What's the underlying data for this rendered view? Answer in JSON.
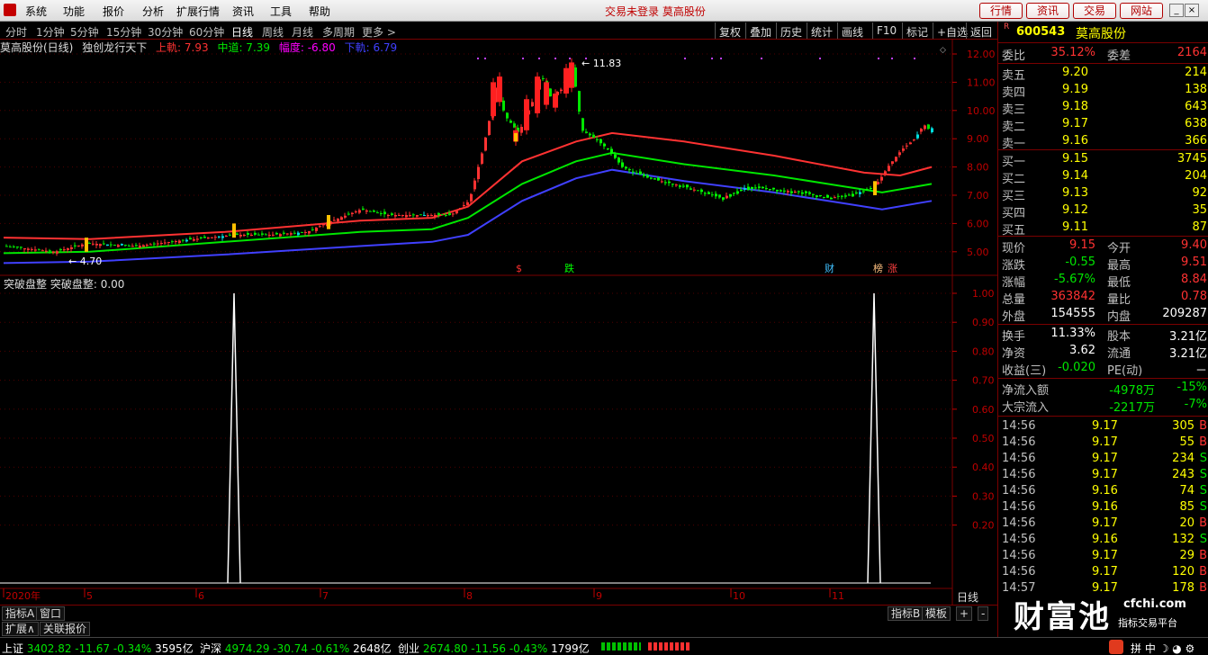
{
  "menu": {
    "items": [
      "系统",
      "功能",
      "报价",
      "分析",
      "扩展行情",
      "资讯",
      "工具",
      "帮助"
    ],
    "center_text": "交易未登录  莫高股份",
    "right_buttons": [
      "行情",
      "资讯",
      "交易",
      "网站"
    ]
  },
  "period_bar": {
    "periods": [
      "分时",
      "1分钟",
      "5分钟",
      "15分钟",
      "30分钟",
      "60分钟",
      "日线",
      "周线",
      "月线",
      "多周期",
      "更多 >"
    ],
    "active": "日线",
    "tools": [
      "复权",
      "叠加",
      "历史",
      "统计",
      "画线",
      "F10",
      "标记",
      "+自选",
      "返回"
    ]
  },
  "chart_header": {
    "name": "莫高股份(日线)",
    "indicator": "独创龙行天下",
    "upper_label": "上軌: 7.93",
    "middle_label": "中道: 7.39",
    "range_label": "幅度: -6.80",
    "lower_label": "下軌: 6.79",
    "colors": {
      "upper": "#ff3232",
      "middle": "#00e600",
      "range": "#ff00ff",
      "lower": "#4040ff"
    }
  },
  "price_axis": [
    "12.00",
    "11.00",
    "10.00",
    "9.00",
    "8.00",
    "7.00",
    "6.00",
    "5.00"
  ],
  "annotations": {
    "high": "11.83",
    "low": "4.70",
    "markers": [
      "$",
      "跌",
      "财",
      "榜",
      "涨"
    ]
  },
  "indicator_header": {
    "name": "突破盘整",
    "value_label": "突破盘整: 0.00"
  },
  "indicator_axis": [
    "1.00",
    "0.90",
    "0.80",
    "0.70",
    "0.60",
    "0.50",
    "0.40",
    "0.30",
    "0.20"
  ],
  "date_axis": [
    "2020年",
    "5",
    "6",
    "7",
    "8",
    "9",
    "10",
    "11"
  ],
  "bottom_tabs": [
    "指标A",
    "窗口",
    "指标B",
    "模板",
    "+",
    "-",
    "扩展∧",
    "关联报价"
  ],
  "daily_label": "日线",
  "quote": {
    "flag": "R",
    "code": "600543",
    "name": "莫高股份",
    "ratio": {
      "label": "委比",
      "value": "35.12%",
      "label2": "委差",
      "value2": "2164"
    },
    "sells": [
      {
        "label": "卖五",
        "price": "9.20",
        "vol": "214"
      },
      {
        "label": "卖四",
        "price": "9.19",
        "vol": "138"
      },
      {
        "label": "卖三",
        "price": "9.18",
        "vol": "643"
      },
      {
        "label": "卖二",
        "price": "9.17",
        "vol": "638"
      },
      {
        "label": "卖一",
        "price": "9.16",
        "vol": "366"
      }
    ],
    "buys": [
      {
        "label": "买一",
        "price": "9.15",
        "vol": "3745"
      },
      {
        "label": "买二",
        "price": "9.14",
        "vol": "204"
      },
      {
        "label": "买三",
        "price": "9.13",
        "vol": "92"
      },
      {
        "label": "买四",
        "price": "9.12",
        "vol": "35"
      },
      {
        "label": "买五",
        "price": "9.11",
        "vol": "87"
      }
    ],
    "stats1": [
      {
        "l": "现价",
        "v": "9.15",
        "l2": "今开",
        "v2": "9.40"
      },
      {
        "l": "涨跌",
        "v": "-0.55",
        "l2": "最高",
        "v2": "9.51"
      },
      {
        "l": "涨幅",
        "v": "-5.67%",
        "l2": "最低",
        "v2": "8.84"
      },
      {
        "l": "总量",
        "v": "363842",
        "l2": "量比",
        "v2": "0.78"
      },
      {
        "l": "外盘",
        "v": "154555",
        "l2": "内盘",
        "v2": "209287"
      }
    ],
    "stats2": [
      {
        "l": "换手",
        "v": "11.33%",
        "l2": "股本",
        "v2": "3.21亿"
      },
      {
        "l": "净资",
        "v": "3.62",
        "l2": "流通",
        "v2": "3.21亿"
      },
      {
        "l": "收益(三)",
        "v": "-0.020",
        "l2": "PE(动)",
        "v2": "－"
      }
    ],
    "flows": [
      {
        "l": "净流入额",
        "v": "-4978万",
        "p": "-15%"
      },
      {
        "l": "大宗流入",
        "v": "-2217万",
        "p": "-7%"
      }
    ],
    "ticks": [
      {
        "t": "14:56",
        "p": "9.17",
        "q": "305",
        "s": "B"
      },
      {
        "t": "14:56",
        "p": "9.17",
        "q": "55",
        "s": "B"
      },
      {
        "t": "14:56",
        "p": "9.17",
        "q": "234",
        "s": "S"
      },
      {
        "t": "14:56",
        "p": "9.17",
        "q": "243",
        "s": "S"
      },
      {
        "t": "14:56",
        "p": "9.16",
        "q": "74",
        "s": "S"
      },
      {
        "t": "14:56",
        "p": "9.16",
        "q": "85",
        "s": "S"
      },
      {
        "t": "14:56",
        "p": "9.17",
        "q": "20",
        "s": "B"
      },
      {
        "t": "14:56",
        "p": "9.16",
        "q": "132",
        "s": "S"
      },
      {
        "t": "14:56",
        "p": "9.17",
        "q": "29",
        "s": "B"
      },
      {
        "t": "14:56",
        "p": "9.17",
        "q": "120",
        "s": "B"
      },
      {
        "t": "14:57",
        "p": "9.17",
        "q": "178",
        "s": "B"
      }
    ]
  },
  "status": [
    {
      "name": "上证",
      "price": "3402.82",
      "chg": "-11.67",
      "pct": "-0.34%",
      "amt": "3595亿"
    },
    {
      "name": "沪深",
      "price": "4974.29",
      "chg": "-30.74",
      "pct": "-0.61%",
      "amt": "2648亿"
    },
    {
      "name": "创业",
      "price": "2674.80",
      "chg": "-11.56",
      "pct": "-0.43%",
      "amt": "1799亿"
    }
  ],
  "watermark": {
    "brand": "财富池",
    "site": "cfchi.com",
    "tagline": "指标交易平台"
  }
}
